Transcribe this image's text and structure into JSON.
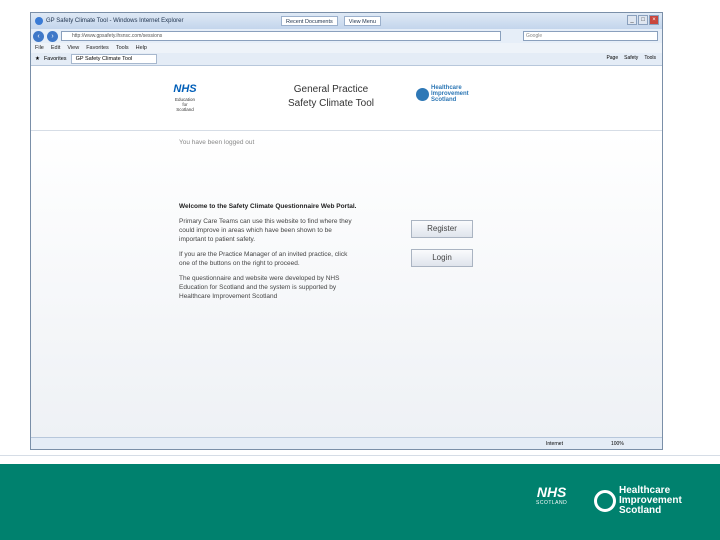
{
  "window": {
    "title": "GP Safety Climate Tool - Windows Internet Explorer",
    "toolbar_items": [
      "Recent Documents",
      "View Menu"
    ]
  },
  "browser": {
    "url": "http://www.gpsafety.ihsnsc.com/sessions",
    "search_placeholder": "Google",
    "menu": [
      "File",
      "Edit",
      "View",
      "Favorites",
      "Tools",
      "Help"
    ],
    "favorites_label": "Favorites",
    "tab_label": "GP Safety Climate Tool",
    "tools": [
      "Page",
      "Safety",
      "Tools"
    ]
  },
  "header": {
    "nhs_logo": "NHS",
    "nhs_sub": [
      "Education",
      "for",
      "Scotland"
    ],
    "app_title_line1": "General Practice",
    "app_title_line2": "Safety Climate Tool",
    "his_logo": [
      "Healthcare",
      "Improvement",
      "Scotland"
    ]
  },
  "main": {
    "logged_out": "You have been logged out",
    "welcome_title": "Welcome to the Safety Climate Questionnaire Web Portal.",
    "para1": "Primary Care Teams can use this website to find where they could improve in areas which have been shown to be important to patient safety.",
    "para2": "If you are the Practice Manager of an invited practice, click one of the buttons on the right to proceed.",
    "para3": "The questionnaire and website were developed by NHS Education for Scotland and the system is supported by Healthcare Improvement Scotland",
    "register_label": "Register",
    "login_label": "Login"
  },
  "status": {
    "zone": "Internet",
    "zoom": "100%"
  },
  "footer": {
    "nhs": "NHS",
    "nhs_sub": "SCOTLAND",
    "his": [
      "Healthcare",
      "Improvement",
      "Scotland"
    ]
  }
}
